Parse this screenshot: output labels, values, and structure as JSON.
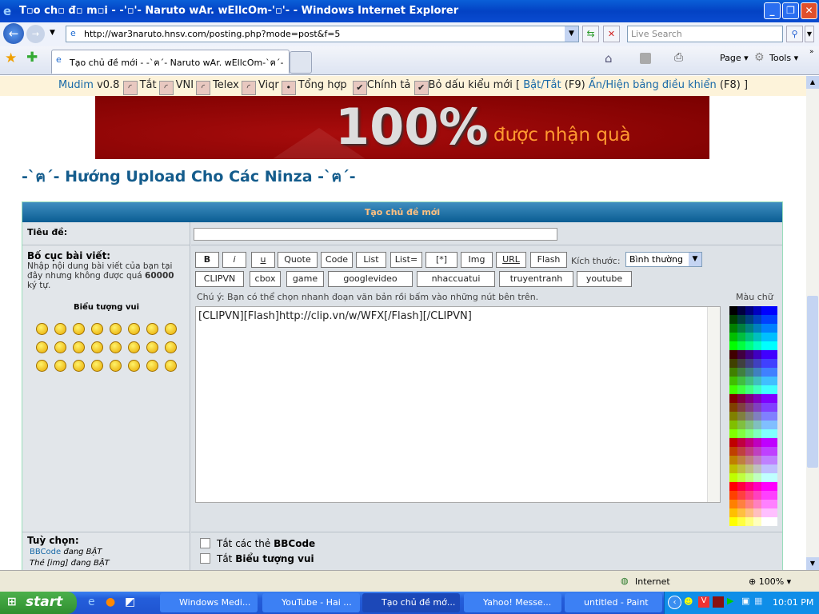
{
  "window": {
    "title": "Tạo chủ đề mới - -'ㅁ'- Naruto wAr. wEllcOm-'ㅁ'- - Windows Internet Explorer",
    "title_display": "T▫o ch▫ đ▫ m▫i - -'▫'- Naruto wAr. wEllcOm-'▫'- - Windows Internet Explorer"
  },
  "browser": {
    "url": "http://war3naruto.hnsv.com/posting.php?mode=post&f=5",
    "search_placeholder": "Live Search",
    "tab_title": "Tạo chủ đề mới - -`ฅ´- Naruto wAr. wEllcOm-`ฅ´-",
    "page_label": "Page",
    "tools_label": "Tools",
    "status_zone": "Internet",
    "zoom": "100%"
  },
  "mudim": {
    "name": "Mudim",
    "version": "v0.8",
    "options": [
      {
        "label": "Tắt",
        "checked": false
      },
      {
        "label": "VNI",
        "checked": false
      },
      {
        "label": "Telex",
        "checked": false
      },
      {
        "label": "Viqr",
        "checked": false
      },
      {
        "label": "Tổng hợp",
        "checked": true
      }
    ],
    "spell": "Chính tả",
    "new_accent": "Bỏ dấu kiểu mới",
    "open_bracket": "[",
    "toggle": "Bật/Tắt",
    "toggle_key": "(F9)",
    "panel": "Ẩn/Hiện bảng điều khiển",
    "panel_key": "(F8)",
    "close_bracket": "]"
  },
  "banner": {
    "big": "100%",
    "text": "được nhận quà"
  },
  "page": {
    "heading": "-`ฅ´- Hướng Upload Cho Các Ninza -`ฅ´-"
  },
  "form": {
    "header": "Tạo chủ đề mới",
    "subject_label": "Tiêu đề:",
    "subject_value": "",
    "body_label": "Bố cục bài viết:",
    "body_help": "Nhập nội dung bài viết của bạn tại đây nhưng không được quá",
    "body_limit": "60000",
    "body_help_end": "ký tự.",
    "smilies_label": "Biểu tượng vui",
    "buttons_row1": [
      "B",
      "i",
      "u",
      "Quote",
      "Code",
      "List",
      "List=",
      "[*]",
      "Img",
      "URL",
      "Flash"
    ],
    "size_label": "Kích thước:",
    "size_value": "Bình thường",
    "buttons_row2": [
      "CLIPVN",
      "cbox",
      "game",
      "googlevideo",
      "nhaccuatui",
      "truyentranh",
      "youtube"
    ],
    "hint": "Chú ý: Bạn có thể chọn nhanh đoạn văn bản rồi bấm vào những nút bên trên.",
    "color_label": "Màu chữ",
    "message": "[CLIPVN][Flash]http://clip.vn/w/WFX[/Flash][/CLIPVN]",
    "options_label": "Tuỳ chọn:",
    "bbcode_link": "BBCode",
    "bbcode_status": "đang BẬT",
    "img_status": "Thẻ [img] đang BẬT",
    "opt1_pre": "Tắt các thẻ",
    "opt1_bold": "BBCode",
    "opt2_pre": "Tắt",
    "opt2_bold": "Biểu tượng vui"
  },
  "taskbar": {
    "start": "start",
    "tasks": [
      "Windows Medi...",
      "YouTube - Hai ...",
      "Tạo chủ đề mớ...",
      "Yahoo! Messe...",
      "untitled - Paint"
    ],
    "active_task": 2,
    "clock": "10:01 PM"
  }
}
